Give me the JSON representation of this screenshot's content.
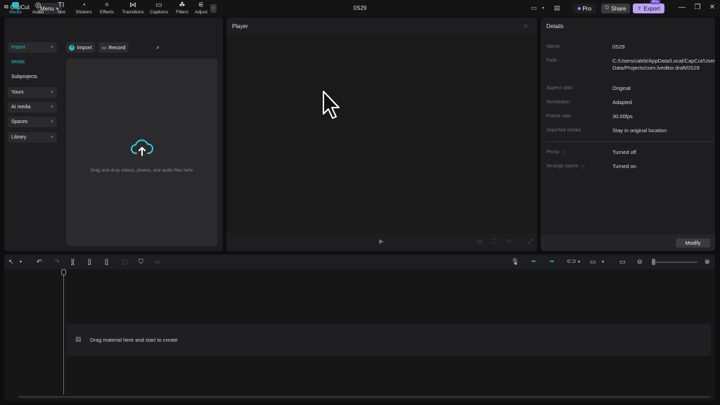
{
  "app": {
    "name": "CapCut",
    "menu_label": "Menu",
    "project_title": "0S29"
  },
  "titlebar": {
    "pro_label": "Pro",
    "share_label": "Share",
    "export_label": "Export",
    "export_badge": "Pro"
  },
  "media_tabs": [
    {
      "label": "Media",
      "icon": "media-icon"
    },
    {
      "label": "Audio",
      "icon": "audio-icon"
    },
    {
      "label": "Text",
      "icon": "text-icon"
    },
    {
      "label": "Stickers",
      "icon": "stickers-icon"
    },
    {
      "label": "Effects",
      "icon": "effects-icon"
    },
    {
      "label": "Transitions",
      "icon": "transitions-icon"
    },
    {
      "label": "Captions",
      "icon": "captions-icon"
    },
    {
      "label": "Filters",
      "icon": "filters-icon"
    },
    {
      "label": "Adjust",
      "icon": "adjust-icon"
    }
  ],
  "left_nav": {
    "import": "Import",
    "media": "Media",
    "subprojects": "Subprojects",
    "yours": "Yours",
    "ai_media": "AI media",
    "spaces": "Spaces",
    "library": "Library"
  },
  "media_panel": {
    "import_button": "Import",
    "record_button": "Record",
    "drop_text": "Drag and drop videos, photos, and audio files here"
  },
  "player": {
    "label": "Player"
  },
  "details": {
    "label": "Details",
    "rows": [
      {
        "label": "Name:",
        "value": "0S29"
      },
      {
        "label": "Path:",
        "value": "C:/Users/caleb/AppData/Local/CapCut/User Data/Projects/com.lveditor.draft/0S29"
      },
      {
        "label": "Aspect ratio:",
        "value": "Original"
      },
      {
        "label": "Resolution:",
        "value": "Adapted"
      },
      {
        "label": "Frame rate:",
        "value": "30.00fps"
      },
      {
        "label": "Imported media:",
        "value": "Stay in original location"
      },
      {
        "label": "Proxy:",
        "value": "Turned off"
      },
      {
        "label": "Arrange layers",
        "value": "Turned on"
      }
    ],
    "modify_button": "Modify"
  },
  "timeline": {
    "empty_text": "Drag material here and start to create"
  },
  "colors": {
    "accent": "#1fc3cc",
    "export_bg": "#b9a3f5",
    "panel_bg": "#1e1e20"
  }
}
